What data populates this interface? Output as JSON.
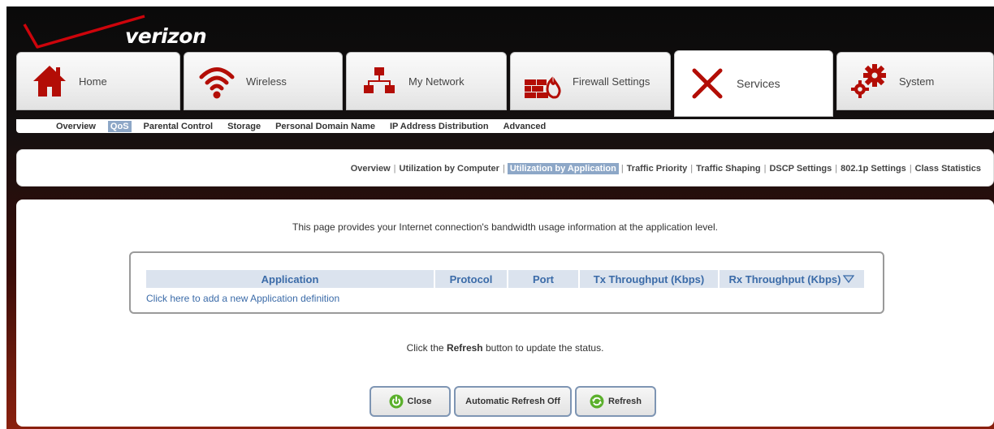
{
  "brand": {
    "logo_text": "verizon",
    "colors": {
      "red": "#cd040b",
      "accent_blue": "#8da7c7",
      "link_blue": "#3b6ba8"
    }
  },
  "nav": {
    "tabs": [
      {
        "label": "Home",
        "icon": "house-icon"
      },
      {
        "label": "Wireless",
        "icon": "wifi-icon"
      },
      {
        "label": "My Network",
        "icon": "network-icon"
      },
      {
        "label": "Firewall Settings",
        "icon": "firewall-icon"
      },
      {
        "label": "Services",
        "icon": "tools-icon",
        "active": true
      },
      {
        "label": "System",
        "icon": "gears-icon"
      }
    ]
  },
  "subnav": {
    "items": [
      "Overview",
      "QoS",
      "Parental Control",
      "Storage",
      "Personal Domain Name",
      "IP Address Distribution",
      "Advanced"
    ],
    "selected": "QoS"
  },
  "section_nav": {
    "items": [
      "Overview",
      "Utilization by Computer",
      "Utilization by Application",
      "Traffic Priority",
      "Traffic Shaping",
      "DSCP Settings",
      "802.1p Settings",
      "Class Statistics"
    ],
    "selected": "Utilization by Application"
  },
  "main": {
    "intro": "This page provides your Internet connection's bandwidth usage information at the application level.",
    "table": {
      "headers": [
        "Application",
        "Protocol",
        "Port",
        "Tx Throughput (Kbps)",
        "Rx Throughput (Kbps)"
      ],
      "sort_icon": "sort-down-icon",
      "add_link": "Click here to add a new Application definition"
    },
    "refresh_note": {
      "prefix": "Click the",
      "bold": "Refresh",
      "suffix": "button to update the status."
    },
    "buttons": {
      "close": "Close",
      "auto_refresh": "Automatic Refresh Off",
      "refresh": "Refresh"
    }
  }
}
